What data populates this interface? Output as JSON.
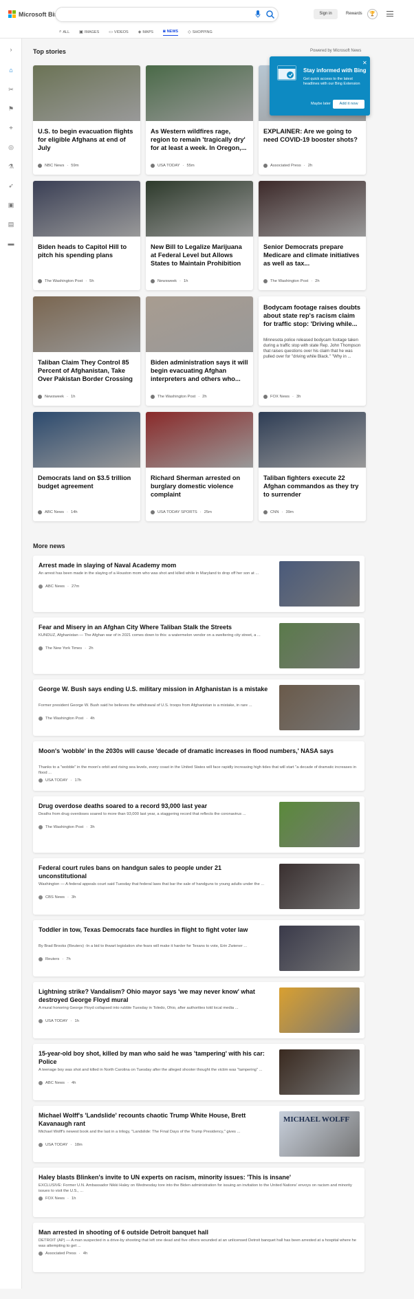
{
  "header": {
    "logo_text": "Microsoft Bing",
    "search_value": "",
    "signin_label": "Sign in",
    "rewards_label": "Rewards",
    "rewards_points": "🏆",
    "tabs": [
      {
        "label": "ALL",
        "icon": "search-icon"
      },
      {
        "label": "IMAGES",
        "icon": "image-icon"
      },
      {
        "label": "VIDEOS",
        "icon": "video-icon"
      },
      {
        "label": "MAPS",
        "icon": "map-icon"
      },
      {
        "label": "NEWS",
        "icon": "news-icon"
      },
      {
        "label": "SHOPPING",
        "icon": "tag-icon"
      }
    ]
  },
  "top_stories": {
    "title": "Top stories",
    "powered_by": "Powered by Microsoft News",
    "cards": [
      {
        "title": "U.S. to begin evacuation flights for eligible Afghans at end of July",
        "source": "NBC News",
        "time": "59m",
        "color": "#6b7355"
      },
      {
        "title": "As Western wildfires rage, region to remain 'tragically dry' for at least a week. In Oregon,...",
        "source": "USA TODAY",
        "time": "55m",
        "color": "#4a6a48"
      },
      {
        "title": "EXPLAINER: Are we going to need COVID-19 booster shots?",
        "source": "Associated Press",
        "time": "2h",
        "color": "#b8c7d3"
      },
      {
        "title": "Biden heads to Capitol Hill to pitch his spending plans",
        "source": "The Washington Post",
        "time": "5h",
        "color": "#3a3f55"
      },
      {
        "title": "New Bill to Legalize Marijuana at Federal Level but Allows States to Maintain Prohibition",
        "source": "Newsweek",
        "time": "1h",
        "color": "#2d3a2b"
      },
      {
        "title": "Senior Democrats prepare Medicare and climate initiatives as well as tax...",
        "source": "The Washington Post",
        "time": "2h",
        "color": "#3d2a2a"
      },
      {
        "title": "Taliban Claim They Control 85 Percent of Afghanistan, Take Over Pakistan Border Crossing",
        "source": "Newsweek",
        "time": "1h",
        "color": "#7a6650"
      },
      {
        "title": "Biden administration says it will begin evacuating Afghan interpreters and others who...",
        "source": "The Washington Post",
        "time": "2h",
        "color": "#a89c90"
      },
      {
        "title": "Bodycam footage raises doubts about state rep's racism claim for traffic stop: 'Driving while...",
        "snippet": "Minnesota police released bodycam footage taken during a traffic stop with state Rep. John Thompson that raises questions over his claim that he was pulled over for \"driving while Black.\" \"Why in ...",
        "source": "FOX News",
        "time": "3h",
        "color": ""
      },
      {
        "title": "Democrats land on $3.5 trillion budget agreement",
        "source": "ABC News",
        "time": "14h",
        "color": "#2c4a6e"
      },
      {
        "title": "Richard Sherman arrested on burglary domestic violence complaint",
        "source": "USA TODAY SPORTS",
        "time": "25m",
        "color": "#8a2a2a"
      },
      {
        "title": "Taliban fighters execute 22 Afghan commandos as they try to surrender",
        "source": "CNN",
        "time": "39m",
        "color": "#2e3d55"
      }
    ]
  },
  "popup": {
    "title": "Stay informed with Bing",
    "text": "Get quick access to the latest headlines with our Bing Extension",
    "later_label": "Maybe later",
    "add_label": "Add it now"
  },
  "more_news": {
    "title": "More news",
    "items": [
      {
        "title": "Arrest made in slaying of Naval Academy mom",
        "snippet": "An arrest has been made in the slaying of a Houston mom who was shot and killed while in Maryland to drop off her son at ...",
        "source": "ABC News",
        "time": "27m",
        "color": "#4a5a7a"
      },
      {
        "title": "Fear and Misery in an Afghan City Where Taliban Stalk the Streets",
        "snippet": "KUNDUZ, Afghanistan — The Afghan war of in 2021 comes down to this: a watermelon vendor on a sweltering city street, a ...",
        "source": "The New York Times",
        "time": "2h",
        "color": "#5a7a4a"
      },
      {
        "title": "George W. Bush says ending U.S. military mission in Afghanistan is a mistake",
        "snippet": "Former president George W. Bush said he believes the withdrawal of U.S. troops from Afghanistan is a mistake, in rare ...",
        "source": "The Washington Post",
        "time": "4h",
        "color": "#6a5a4a"
      },
      {
        "title": "Moon's 'wobble' in the 2030s will cause 'decade of dramatic increases in flood numbers,' NASA says",
        "snippet": "Thanks to a \"wobble\" in the moon's orbit and rising sea levels, every coast in the United States will face rapidly increasing high tides that will start \"a decade of dramatic increases in flood ...",
        "source": "USA TODAY",
        "time": "17h",
        "color": ""
      },
      {
        "title": "Drug overdose deaths soared to a record 93,000 last year",
        "snippet": "Deaths from drug overdoses soared to more than 93,000 last year, a staggering record that reflects the coronavirus ...",
        "source": "The Washington Post",
        "time": "3h",
        "color": "#5a8a3a"
      },
      {
        "title": "Federal court rules bans on handgun sales to people under 21 unconstitutional",
        "snippet": "Washington — A federal appeals court said Tuesday that federal laws that bar the sale of handguns to young adults under the ...",
        "source": "CBS News",
        "time": "3h",
        "color": "#3a3030"
      },
      {
        "title": "Toddler in tow, Texas Democrats face hurdles in flight to fight voter law",
        "snippet": "By Brad Brooks (Reuters) -In a bid to thwart legislation she fears will make it harder for Texans to vote, Erin Zwiener ...",
        "source": "Reuters",
        "time": "7h",
        "color": "#3a3a4a"
      },
      {
        "title": "Lightning strike? Vandalism? Ohio mayor says 'we may never know' what destroyed George Floyd mural",
        "snippet": "A mural honoring George Floyd collapsed into rubble Tuesday in Toledo, Ohio, after authorities told local media ...",
        "source": "USA TODAY",
        "time": "1h",
        "color": "#d9a030"
      },
      {
        "title": "15-year-old boy shot, killed by man who said he was 'tampering' with his car: Police",
        "snippet": "A teenage boy was shot and killed in North Carolina on Tuesday after the alleged shooter thought the victim was \"tampering\" ...",
        "source": "ABC News",
        "time": "4h",
        "color": "#3a2a20"
      },
      {
        "title": "Michael Wolff's 'Landslide' recounts chaotic Trump White House, Brett Kavanaugh rant",
        "snippet": "Michael Wolff's newest book and the last in a trilogy, \"Landslide: The Final Days of the Trump Presidency,\" gives ...",
        "source": "USA TODAY",
        "time": "18m",
        "color": "#c8d0dc",
        "thumb_text": "MICHAEL WOLFF"
      },
      {
        "title": "Haley blasts Blinken's invite to UN experts on racism, minority issues: 'This is insane'",
        "snippet": "EXCLUSIVE: Former U.N. Ambassador Nikki Haley on Wednesday tore into the Biden administration for issuing an invitation to the United Nations' envoys on racism and minority issues to visit the U.S., ...",
        "source": "FOX News",
        "time": "1h",
        "color": ""
      },
      {
        "title": "Man arrested in shooting of 6 outside Detroit banquet hall",
        "snippet": "DETROIT (AP) — A man suspected in a drive-by shooting that left one dead and five others wounded at an unlicensed Detroit banquet hall has been arrested at a hospital where he was attempting to get ...",
        "source": "Associated Press",
        "time": "4h",
        "color": ""
      }
    ]
  },
  "colors": {
    "accent": "#174ae4",
    "popup": "#0d8ac2"
  }
}
